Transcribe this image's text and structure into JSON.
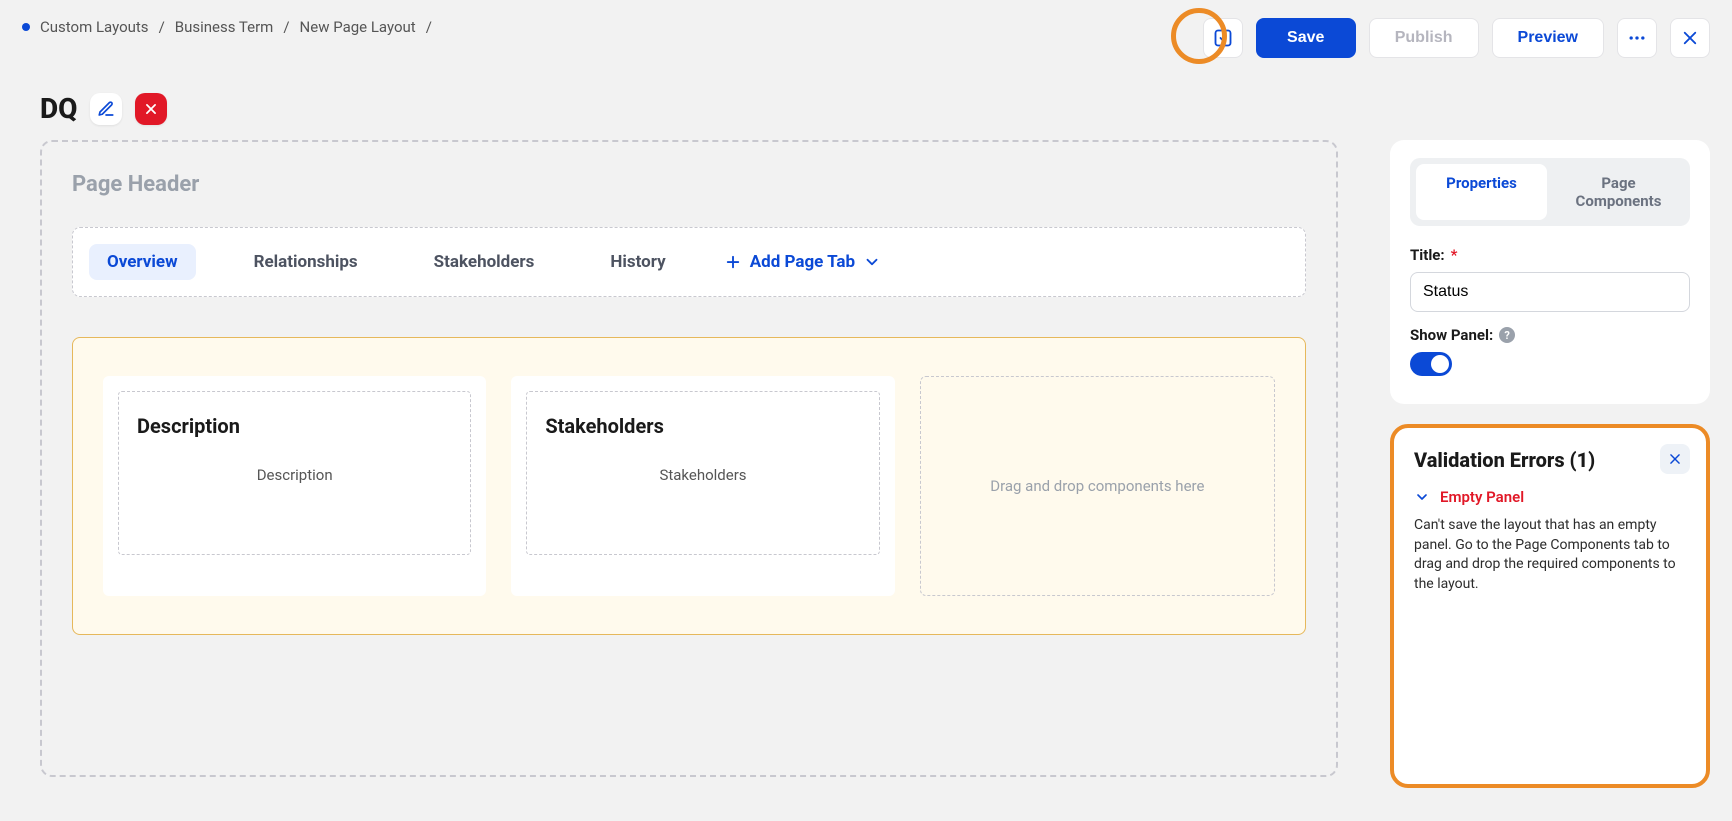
{
  "breadcrumbs": [
    "Custom Layouts",
    "Business Term",
    "New Page Layout"
  ],
  "toolbar": {
    "save": "Save",
    "publish": "Publish",
    "preview": "Preview"
  },
  "page_title": "DQ",
  "header_label": "Page Header",
  "tabs": {
    "items": [
      "Overview",
      "Relationships",
      "Stakeholders",
      "History"
    ],
    "add_label": "Add Page Tab"
  },
  "panels": {
    "a": {
      "title": "Description",
      "sub": "Description"
    },
    "b": {
      "title": "Stakeholders",
      "sub": "Stakeholders"
    },
    "drop_hint": "Drag and drop components here"
  },
  "sidebar": {
    "tab_props": "Properties",
    "tab_comps": "Page Components",
    "title_label": "Title:",
    "title_value": "Status",
    "show_panel_label": "Show Panel:"
  },
  "validation": {
    "header": "Validation Errors (1)",
    "err_name": "Empty Panel",
    "err_desc": "Can't save the layout that has an empty panel. Go to the Page Components tab to drag and drop the required components to the layout."
  }
}
